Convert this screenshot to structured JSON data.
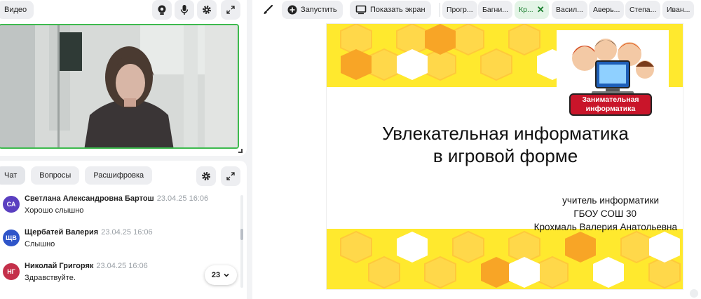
{
  "video": {
    "tab_label": "Видео",
    "icons": [
      "camera-icon",
      "microphone-icon",
      "settings-gear-icon",
      "expand-icon"
    ]
  },
  "chat": {
    "tabs": [
      {
        "label": "Чат",
        "active": true
      },
      {
        "label": "Вопросы",
        "active": false
      },
      {
        "label": "Расшифровка",
        "active": false
      }
    ],
    "messages": [
      {
        "initials": "СА",
        "name": "Светлана Александровна Бартош",
        "time": "23.04.25 16:06",
        "text": "Хорошо слышно",
        "avatar_color": "#5a3fc0"
      },
      {
        "initials": "ЩВ",
        "name": "Щербатей Валерия",
        "time": "23.04.25 16:06",
        "text": "Слышно",
        "avatar_color": "#2f55c9"
      },
      {
        "initials": "НГ",
        "name": "Николай Григоряк",
        "time": "23.04.25 16:06",
        "text": "Здравствуйте.",
        "avatar_color": "#c4304a"
      }
    ],
    "unread_count": "23"
  },
  "toolbar": {
    "start_label": "Запустить",
    "share_screen_label": "Показать экран",
    "participants": [
      {
        "label": "Прогр...",
        "active": false
      },
      {
        "label": "Багни...",
        "active": false
      },
      {
        "label": "Кр...",
        "active": true
      },
      {
        "label": "Васил...",
        "active": false
      },
      {
        "label": "Аверь...",
        "active": false
      },
      {
        "label": "Степа...",
        "active": false
      },
      {
        "label": "Иван...",
        "active": false
      }
    ]
  },
  "slide": {
    "title_line1": "Увлекательная информатика",
    "title_line2": "в игровой форме",
    "author_line1": "учитель информатики",
    "author_line2": "ГБОУ СОШ 30",
    "author_line3": "Крохмаль Валерия Анатольевна",
    "logo_line1": "Занимательная",
    "logo_line2": "информатика"
  },
  "colors": {
    "accent_green": "#3dba4e",
    "honeycomb_yellow": "#ffe92e",
    "honeycomb_orange": "#f8a526"
  }
}
